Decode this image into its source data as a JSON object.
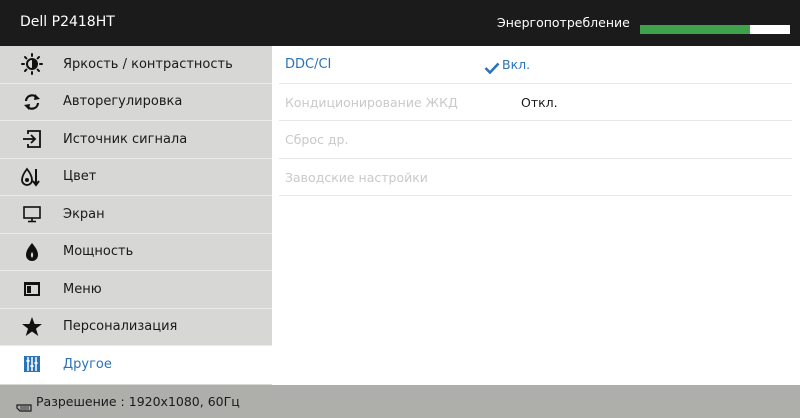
{
  "header": {
    "model": "Dell P2418HT",
    "power_label": "Энергопотребление",
    "power_level_percent": 73
  },
  "sidebar": {
    "items": [
      {
        "label": "Яркость / контрастность",
        "icon": "brightness-icon"
      },
      {
        "label": "Авторегулировка",
        "icon": "auto-adjust-icon"
      },
      {
        "label": "Источник сигнала",
        "icon": "input-source-icon"
      },
      {
        "label": "Цвет",
        "icon": "color-icon"
      },
      {
        "label": "Экран",
        "icon": "display-icon"
      },
      {
        "label": "Мощность",
        "icon": "power-icon"
      },
      {
        "label": "Меню",
        "icon": "menu-icon"
      },
      {
        "label": "Персонализация",
        "icon": "star-icon"
      },
      {
        "label": "Другое",
        "icon": "others-icon",
        "active": true
      }
    ]
  },
  "main": {
    "rows": [
      {
        "label": "DDC/CI",
        "value": "Вкл.",
        "selected": true,
        "checked": true
      },
      {
        "label": "Кондиционирование ЖКД",
        "value": "Откл."
      },
      {
        "label": "Сброс др.",
        "value": ""
      },
      {
        "label": "Заводские настройки",
        "value": ""
      }
    ]
  },
  "footer": {
    "resolution_text": "Разрешение : 1920x1080, 60Гц",
    "icon": "display-port-icon"
  },
  "colors": {
    "header_bg": "#1b1b1b",
    "sidebar_bg": "#d7d7d5",
    "accent_blue": "#2b73b9",
    "power_green": "#3ea24c",
    "footer_bg": "#aeaeab"
  }
}
